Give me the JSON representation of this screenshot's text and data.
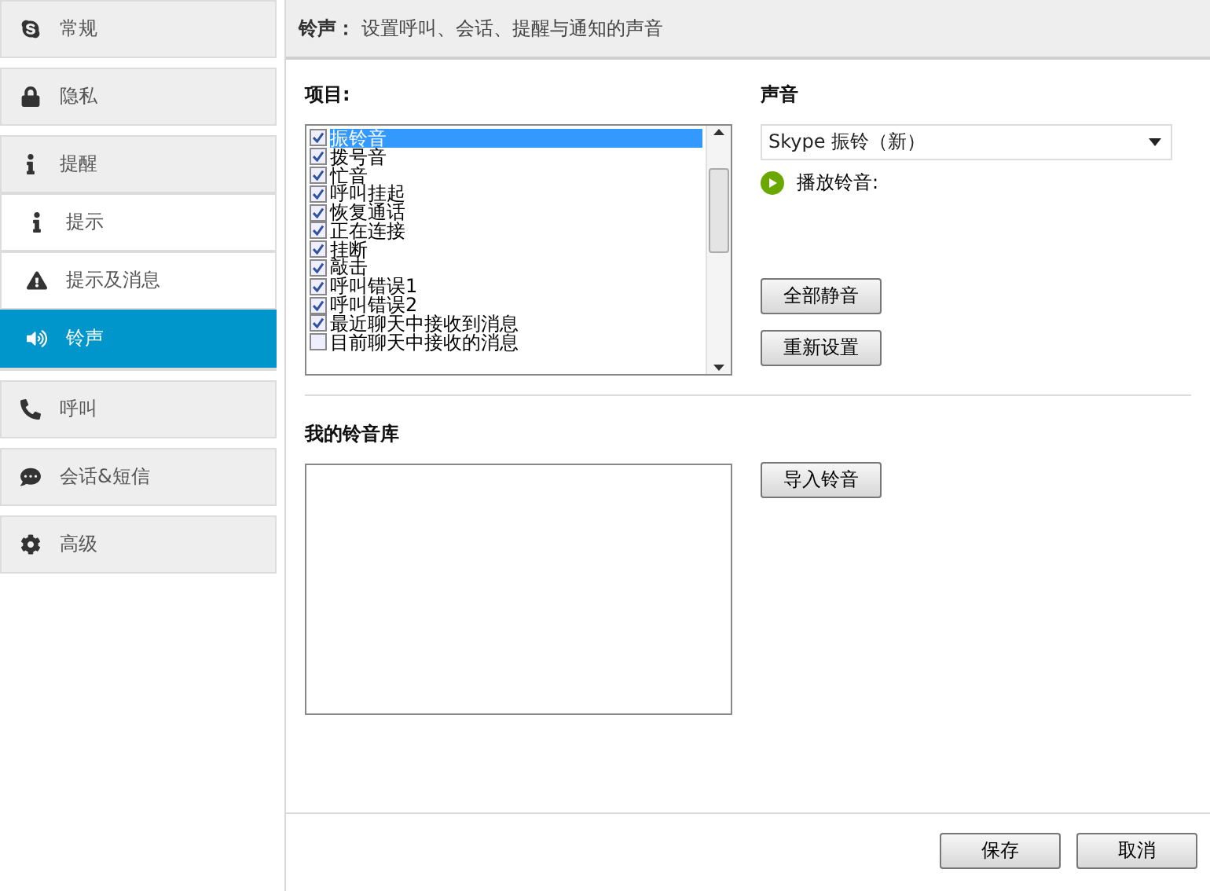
{
  "sidebar": {
    "items": [
      {
        "label": "常规",
        "selected": false
      },
      {
        "label": "隐私",
        "selected": false
      },
      {
        "label": "提醒",
        "selected": false,
        "children": [
          {
            "label": "提示",
            "selected": false
          },
          {
            "label": "提示及消息",
            "selected": false
          },
          {
            "label": "铃声",
            "selected": true
          }
        ]
      },
      {
        "label": "呼叫",
        "selected": false
      },
      {
        "label": "会话&短信",
        "selected": false
      },
      {
        "label": "高级",
        "selected": false
      }
    ]
  },
  "header": {
    "title": "铃声：",
    "description": "设置呼叫、会话、提醒与通知的声音"
  },
  "items_label": "项目:",
  "items": [
    {
      "label": "振铃音",
      "checked": true,
      "selected": true
    },
    {
      "label": "拨号音",
      "checked": true,
      "selected": false
    },
    {
      "label": "忙音",
      "checked": true,
      "selected": false
    },
    {
      "label": "呼叫挂起",
      "checked": true,
      "selected": false
    },
    {
      "label": "恢复通话",
      "checked": true,
      "selected": false
    },
    {
      "label": "正在连接",
      "checked": true,
      "selected": false
    },
    {
      "label": "挂断",
      "checked": true,
      "selected": false
    },
    {
      "label": "敲击",
      "checked": true,
      "selected": false
    },
    {
      "label": "呼叫错误1",
      "checked": true,
      "selected": false
    },
    {
      "label": "呼叫错误2",
      "checked": true,
      "selected": false
    },
    {
      "label": "最近聊天中接收到消息",
      "checked": true,
      "selected": false
    },
    {
      "label": "目前聊天中接收的消息",
      "checked": false,
      "selected": false
    }
  ],
  "sound": {
    "label": "声音",
    "value": "Skype 振铃（新）",
    "play": "播放铃音:",
    "buttons": [
      "全部静音",
      "重新设置"
    ]
  },
  "library": {
    "label": "我的铃音库",
    "button": "导入铃音"
  },
  "footer_buttons": [
    "保存",
    "取消"
  ]
}
